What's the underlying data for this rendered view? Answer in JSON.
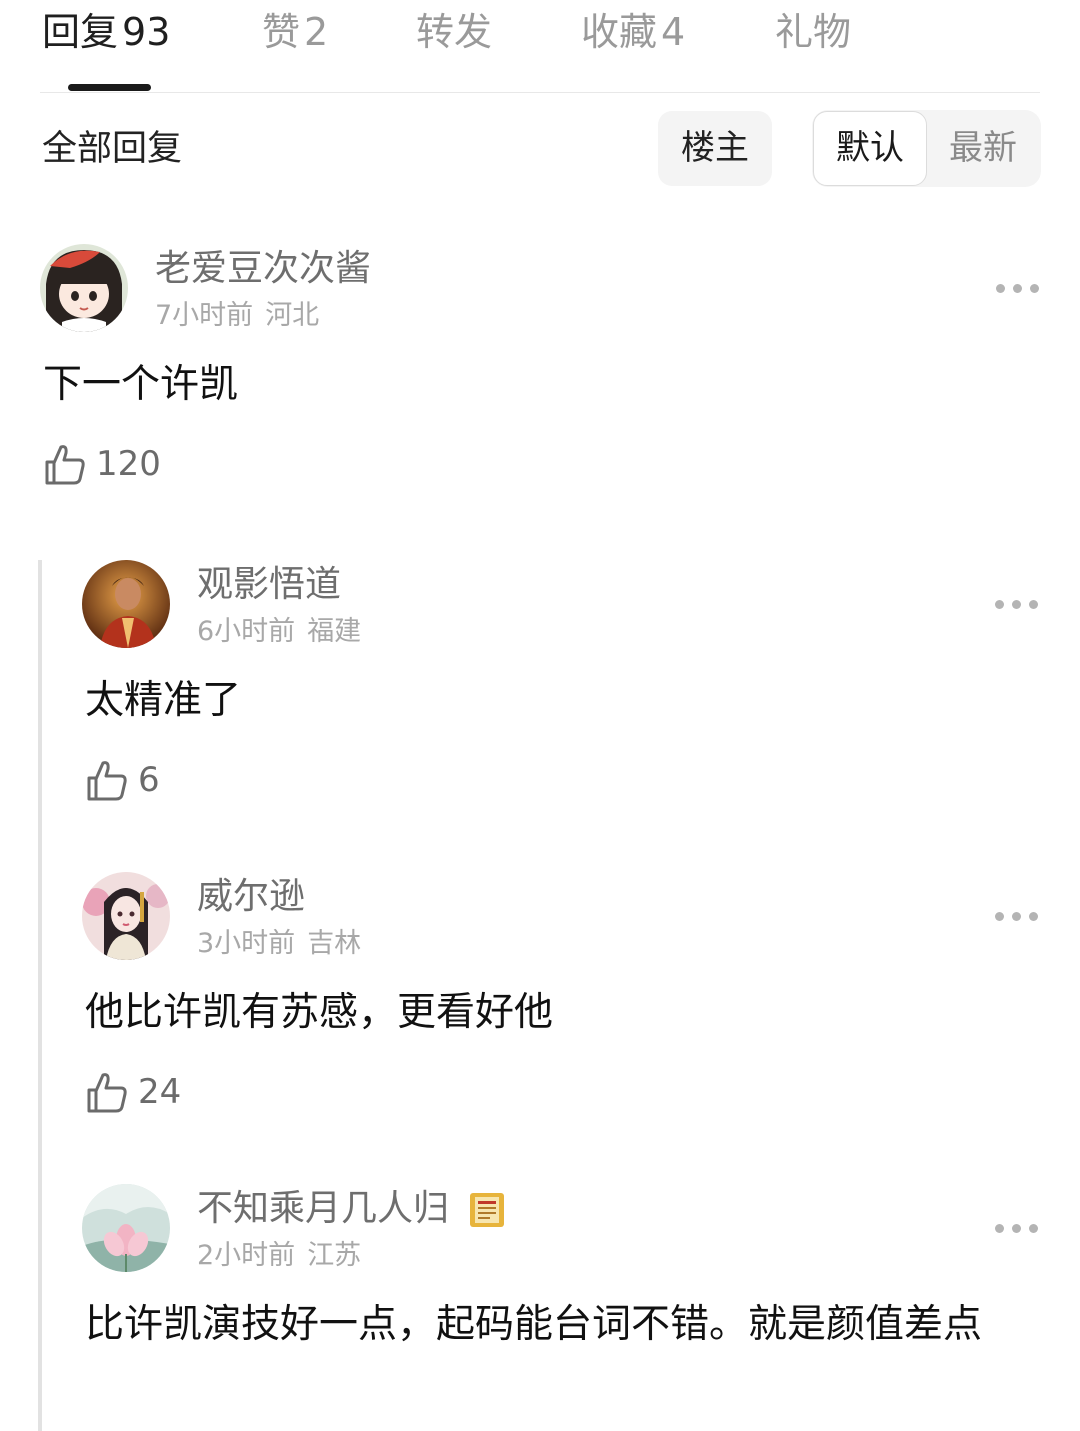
{
  "tabs": [
    {
      "label": "回复",
      "count": "93"
    },
    {
      "label": "赞",
      "count": "2"
    },
    {
      "label": "转发",
      "count": ""
    },
    {
      "label": "收藏",
      "count": "4"
    },
    {
      "label": "礼物",
      "count": ""
    }
  ],
  "filter": {
    "title": "全部回复",
    "owner_button": "楼主",
    "sort_default": "默认",
    "sort_latest": "最新"
  },
  "comment": {
    "username": "老爱豆次次酱",
    "time": "7小时前",
    "location": "河北",
    "text": "下一个许凯",
    "likes": "120"
  },
  "replies": [
    {
      "username": "观影悟道",
      "time": "6小时前",
      "location": "福建",
      "text": "太精准了",
      "likes": "6"
    },
    {
      "username": "威尔逊",
      "time": "3小时前",
      "location": "吉林",
      "text": "他比许凯有苏感，更看好他",
      "likes": "24"
    },
    {
      "username": "不知乘月几人归",
      "time": "2小时前",
      "location": "江苏",
      "text": "比许凯演技好一点，起码能台词不错。就是颜值差点",
      "likes": ""
    }
  ],
  "icons": {
    "like": "thumbs-up-icon",
    "more": "more-horizontal-icon",
    "badge": "scroll-badge-icon"
  },
  "colors": {
    "active_text": "#1f1f1f",
    "inactive_text": "#9a9a9a",
    "meta_text": "#a8a8a8",
    "username_text": "#6e6e6e"
  }
}
